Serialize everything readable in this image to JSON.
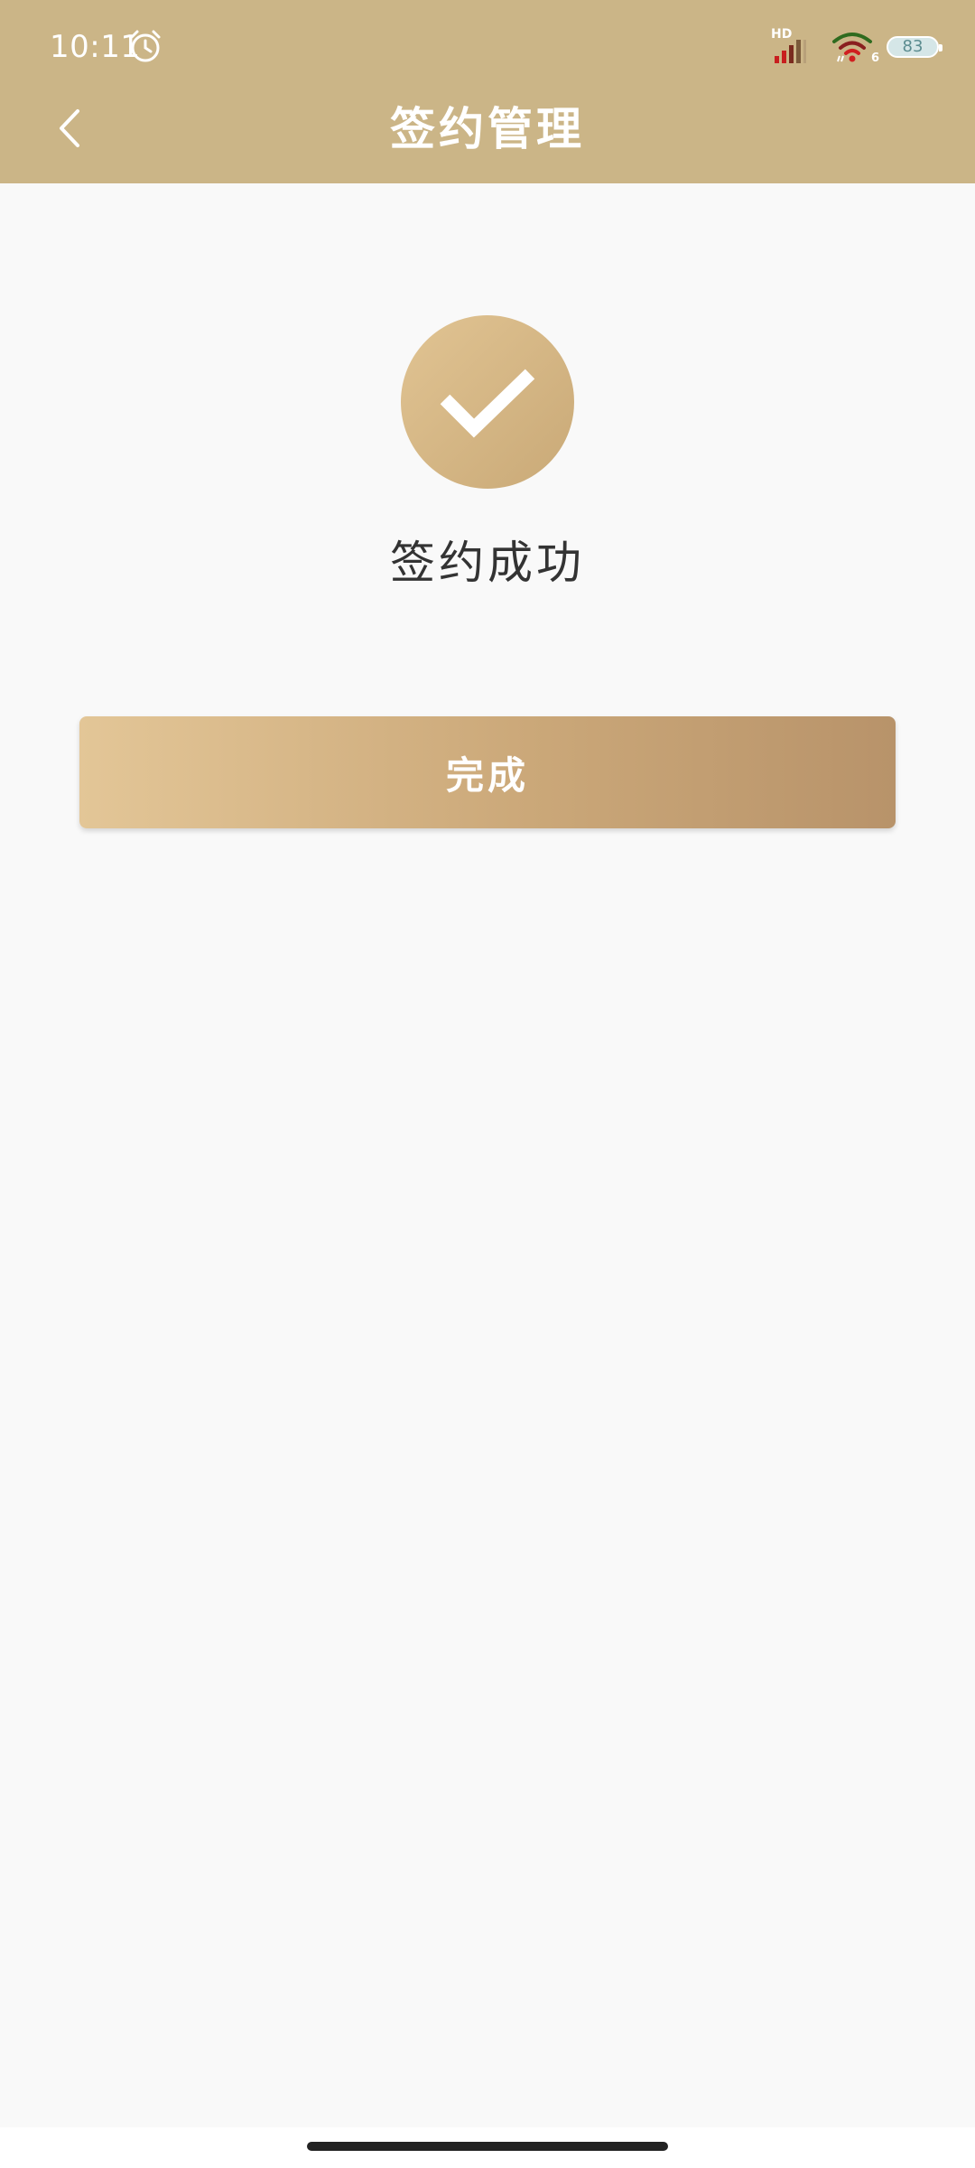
{
  "status_bar": {
    "time": "10:11",
    "network_label": "HD",
    "wifi_badge": "6",
    "battery_level": "83"
  },
  "nav": {
    "title": "签约管理",
    "back_icon": "chevron-left-icon"
  },
  "result": {
    "icon": "check-icon",
    "message": "签约成功"
  },
  "actions": {
    "done_label": "完成"
  },
  "colors": {
    "header": "#cbb587",
    "accent_start": "#e3c697",
    "accent_end": "#b8936a",
    "background": "#f9f9f9"
  }
}
